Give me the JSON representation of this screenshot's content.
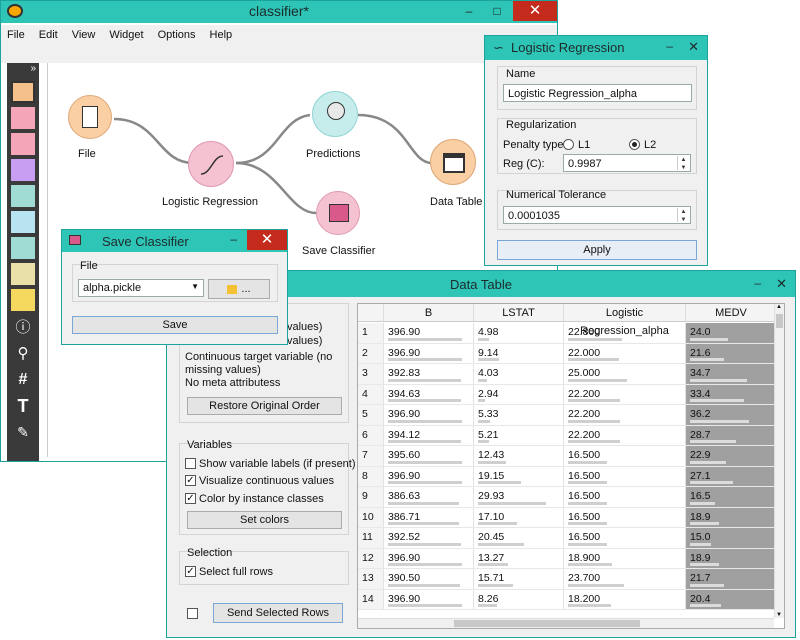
{
  "main_window": {
    "title": "classifier*",
    "menu": [
      "File",
      "Edit",
      "View",
      "Widget",
      "Options",
      "Help"
    ],
    "toolbar_expand": "»",
    "nodes": {
      "file": "File",
      "logreg": "Logistic Regression",
      "predictions": "Predictions",
      "save_classifier": "Save Classifier",
      "data_table": "Data Table"
    }
  },
  "logreg_window": {
    "title": "Logistic Regression",
    "name_group": "Name",
    "name_value": "Logistic Regression_alpha",
    "reg_group": "Regularization",
    "penalty_label": "Penalty type:",
    "penalty_l1": "L1",
    "penalty_l2": "L2",
    "penalty_selected": "L2",
    "reg_label": "Reg (C):",
    "reg_value": "0.9987",
    "tol_group": "Numerical Tolerance",
    "tol_value": "0.0001035",
    "apply_label": "Apply"
  },
  "save_window": {
    "title": "Save Classifier",
    "file_group": "File",
    "file_value": "alpha.pickle",
    "browse_label": "...",
    "save_label": "Save"
  },
  "datatable_window": {
    "title": "Data Table",
    "info": {
      "line1": "values)",
      "line2": "values)",
      "line3": "Continuous target variable (no missing values)",
      "line4": "No meta attributess"
    },
    "restore_label": "Restore Original Order",
    "variables_group": "Variables",
    "show_labels": "Show variable labels (if present)",
    "visualize": "Visualize continuous values",
    "color_by": "Color by instance classes",
    "set_colors": "Set colors",
    "selection_group": "Selection",
    "select_full_rows": "Select full rows",
    "send_rows": "Send Selected Rows",
    "columns": [
      "B",
      "LSTAT",
      "Logistic Regression_alpha",
      "MEDV"
    ],
    "rows": [
      {
        "n": "1",
        "b": "396.90",
        "lstat": "4.98",
        "lr": "22.800",
        "medv": "24.0",
        "fb": 0.9,
        "fl": 0.14,
        "fr": 0.47,
        "fm": 0.46
      },
      {
        "n": "2",
        "b": "396.90",
        "lstat": "9.14",
        "lr": "22.000",
        "medv": "21.6",
        "fb": 0.9,
        "fl": 0.25,
        "fr": 0.45,
        "fm": 0.41
      },
      {
        "n": "3",
        "b": "392.83",
        "lstat": "4.03",
        "lr": "25.000",
        "medv": "34.7",
        "fb": 0.89,
        "fl": 0.11,
        "fr": 0.52,
        "fm": 0.69
      },
      {
        "n": "4",
        "b": "394.63",
        "lstat": "2.94",
        "lr": "22.200",
        "medv": "33.4",
        "fb": 0.89,
        "fl": 0.08,
        "fr": 0.46,
        "fm": 0.66
      },
      {
        "n": "5",
        "b": "396.90",
        "lstat": "5.33",
        "lr": "22.200",
        "medv": "36.2",
        "fb": 0.9,
        "fl": 0.15,
        "fr": 0.46,
        "fm": 0.72
      },
      {
        "n": "6",
        "b": "394.12",
        "lstat": "5.21",
        "lr": "22.200",
        "medv": "28.7",
        "fb": 0.89,
        "fl": 0.14,
        "fr": 0.46,
        "fm": 0.56
      },
      {
        "n": "7",
        "b": "395.60",
        "lstat": "12.43",
        "lr": "16.500",
        "medv": "22.9",
        "fb": 0.9,
        "fl": 0.34,
        "fr": 0.34,
        "fm": 0.44
      },
      {
        "n": "8",
        "b": "396.90",
        "lstat": "19.15",
        "lr": "16.500",
        "medv": "27.1",
        "fb": 0.9,
        "fl": 0.53,
        "fr": 0.34,
        "fm": 0.52
      },
      {
        "n": "9",
        "b": "386.63",
        "lstat": "29.93",
        "lr": "16.500",
        "medv": "16.5",
        "fb": 0.87,
        "fl": 0.83,
        "fr": 0.34,
        "fm": 0.3
      },
      {
        "n": "10",
        "b": "386.71",
        "lstat": "17.10",
        "lr": "16.500",
        "medv": "18.9",
        "fb": 0.87,
        "fl": 0.47,
        "fr": 0.34,
        "fm": 0.35
      },
      {
        "n": "11",
        "b": "392.52",
        "lstat": "20.45",
        "lr": "16.500",
        "medv": "15.0",
        "fb": 0.89,
        "fl": 0.56,
        "fr": 0.34,
        "fm": 0.26
      },
      {
        "n": "12",
        "b": "396.90",
        "lstat": "13.27",
        "lr": "18.900",
        "medv": "18.9",
        "fb": 0.9,
        "fl": 0.37,
        "fr": 0.39,
        "fm": 0.35
      },
      {
        "n": "13",
        "b": "390.50",
        "lstat": "15.71",
        "lr": "23.700",
        "medv": "21.7",
        "fb": 0.88,
        "fl": 0.43,
        "fr": 0.49,
        "fm": 0.41
      },
      {
        "n": "14",
        "b": "396.90",
        "lstat": "8.26",
        "lr": "18.200",
        "medv": "20.4",
        "fb": 0.9,
        "fl": 0.23,
        "fr": 0.38,
        "fm": 0.38
      }
    ]
  }
}
